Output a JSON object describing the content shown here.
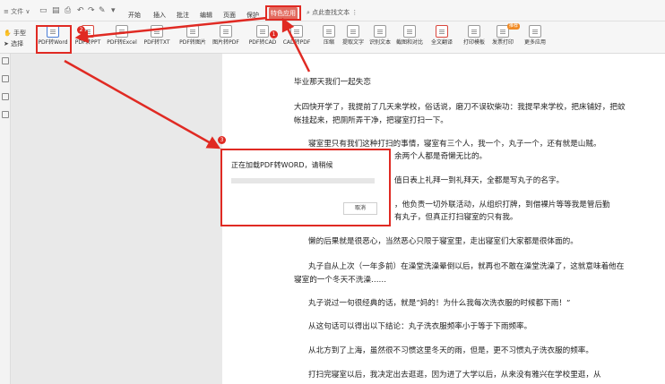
{
  "menubar": {
    "file_label": "≡ 文件 ∨",
    "tabs": [
      "开始",
      "插入",
      "批注",
      "编辑",
      "页面",
      "保护"
    ],
    "special_tab": "特色应用",
    "search_text": "点此查找文本"
  },
  "ribbon": {
    "tools": [
      {
        "label": "PDF转Word",
        "icon": "pdf-to-word-icon"
      },
      {
        "label": "PDF转PPT",
        "icon": "pdf-to-ppt-icon"
      },
      {
        "label": "PDF转Excel",
        "icon": "pdf-to-excel-icon"
      },
      {
        "label": "PDF转TXT",
        "icon": "pdf-to-txt-icon"
      },
      {
        "label": "PDF转图片",
        "icon": "pdf-to-image-icon"
      },
      {
        "label": "图片转PDF",
        "icon": "image-to-pdf-icon"
      },
      {
        "label": "PDF转CAD",
        "icon": "pdf-to-cad-icon"
      },
      {
        "label": "CAD转PDF",
        "icon": "cad-to-pdf-icon"
      },
      {
        "label": "压缩",
        "icon": "compress-icon"
      },
      {
        "label": "提取文字",
        "icon": "extract-text-icon"
      },
      {
        "label": "识别文本",
        "icon": "ocr-icon"
      },
      {
        "label": "截图和对比",
        "icon": "screenshot-icon"
      },
      {
        "label": "全文翻译",
        "icon": "translate-icon"
      },
      {
        "label": "打印模板",
        "icon": "print-template-icon"
      },
      {
        "label": "发票打印",
        "icon": "invoice-print-icon"
      },
      {
        "label": "更多应用",
        "icon": "more-apps-icon"
      }
    ],
    "badge_text": "推荐"
  },
  "mode_panel": {
    "hand_label": "手型",
    "select_label": "选择"
  },
  "document": {
    "paragraphs": [
      "毕业那天我们一起失恋",
      "大四快开学了，我提前了几天来学校，俗话说，磨刀不误砍柴功：我提早来学校，把床铺好，把蚊帐挂起来，把厕所弄干净，把寝室打扫一下。",
      "寝室里只有我们这种打扫的事情，寝室有三个人，我一个，丸子一个，还有就是山贼。",
      "余两个人都是奇懒无比的。",
      "值日表上礼拜一到礼拜天，全都是写丸子的名字。",
      "，他负责一切外联活动，从组织打牌，到借裸片等等我是管后勤",
      "有丸子，但真正打扫寝室的只有我。",
      "懒的后果就是很恶心，当然恶心只限于寝室里，走出寝室们大家都是很体面的。",
      "丸子自从上次（一年多前）在澡堂洗澡晕倒以后，就再也不敢在澡堂洗澡了，这就意味着他在寝室的一个冬天不洗澡……",
      "丸子说过一句很经典的话，就是“妈的！为什么我每次洗衣服的时候都下雨！”",
      "从这句话可以得出以下结论：丸子洗衣服频率小于等于下雨频率。",
      "从北方到了上海，虽然很不习惯这里冬天的雨，但是，更不习惯丸子洗衣服的频率。",
      "打扫完寝室以后，我决定出去逛逛，因为进了大学以后，从来没有雅兴在学校里逛，从"
    ]
  },
  "dialog": {
    "title": "正在加载PDF转WORD，请稍候",
    "progress": 0.0,
    "cancel_label": "取消"
  },
  "annotations": {
    "step1": "1",
    "step2": "2",
    "step3": "3",
    "color": "#e02a23"
  }
}
